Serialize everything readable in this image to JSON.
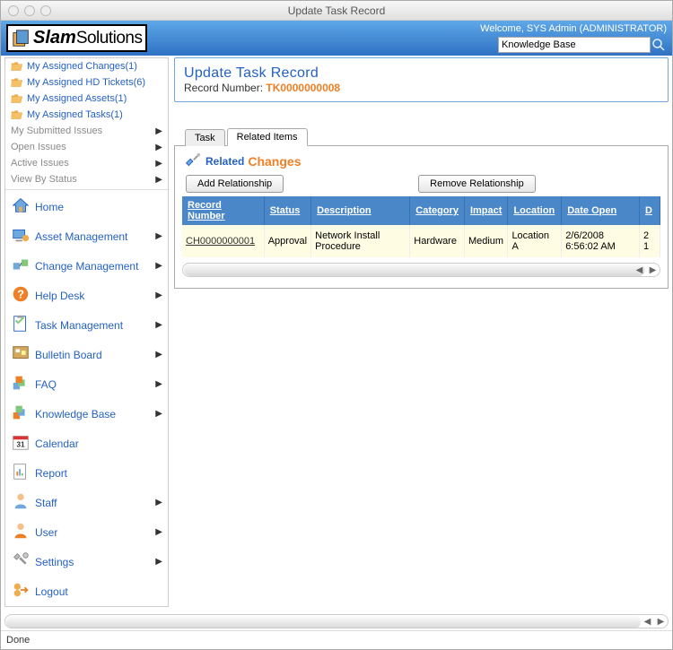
{
  "window": {
    "title": "Update Task Record",
    "status": "Done"
  },
  "header": {
    "logo_main": "Slam",
    "logo_sub": "Solutions",
    "welcome": "Welcome, SYS Admin (ADMINISTRATOR)",
    "search_value": "Knowledge Base"
  },
  "sidebar": {
    "quick_links": [
      {
        "label": "My Assigned Changes(1)"
      },
      {
        "label": "My Assigned HD Tickets(6)"
      },
      {
        "label": "My Assigned Assets(1)"
      },
      {
        "label": "My Assigned Tasks(1)"
      }
    ],
    "sub_links": [
      {
        "label": "My Submitted Issues"
      },
      {
        "label": "Open Issues"
      },
      {
        "label": "Active Issues"
      },
      {
        "label": "View By Status"
      }
    ],
    "nav": [
      {
        "label": "Home",
        "arrow": false
      },
      {
        "label": "Asset Management",
        "arrow": true
      },
      {
        "label": "Change Management",
        "arrow": true
      },
      {
        "label": "Help Desk",
        "arrow": true
      },
      {
        "label": "Task Management",
        "arrow": true
      },
      {
        "label": "Bulletin Board",
        "arrow": true
      },
      {
        "label": "FAQ",
        "arrow": true
      },
      {
        "label": "Knowledge Base",
        "arrow": true
      },
      {
        "label": "Calendar",
        "arrow": false
      },
      {
        "label": "Report",
        "arrow": false
      },
      {
        "label": "Staff",
        "arrow": true
      },
      {
        "label": "User",
        "arrow": true
      },
      {
        "label": "Settings",
        "arrow": true
      },
      {
        "label": "Logout",
        "arrow": false
      }
    ]
  },
  "content": {
    "page_title": "Update Task Record",
    "record_label": "Record Number: ",
    "record_number": "TK0000000008",
    "tabs": [
      {
        "label": "Task"
      },
      {
        "label": "Related Items"
      }
    ],
    "related_label": "Related",
    "related_sub": "Changes",
    "buttons": {
      "add": "Add Relationship",
      "remove": "Remove Relationship"
    },
    "table": {
      "headers": [
        "Record Number",
        "Status",
        "Description",
        "Category",
        "Impact",
        "Location",
        "Date Open",
        "D"
      ],
      "row": {
        "record": "CH0000000001",
        "status": "Approval",
        "description": "Network Install Procedure",
        "category": "Hardware",
        "impact": "Medium",
        "location": "Location A",
        "date": "2/6/2008 6:56:02 AM",
        "extra": "2\n1"
      }
    }
  }
}
